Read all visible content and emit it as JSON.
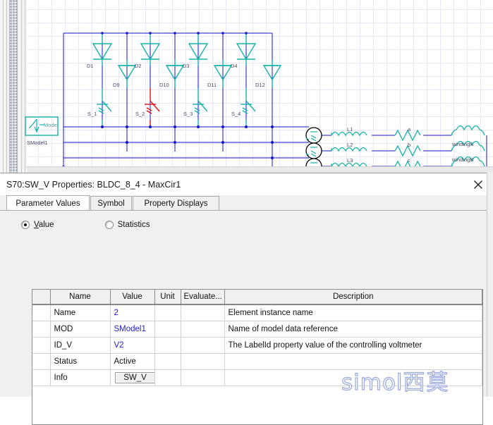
{
  "dialog": {
    "title": "S70:SW_V Properties: BLDC_8_4 - MaxCir1",
    "close_label": "×",
    "tabs": [
      {
        "label": "Parameter Values",
        "active": true
      },
      {
        "label": "Symbol",
        "active": false
      },
      {
        "label": "Property Displays",
        "active": false
      }
    ],
    "radios": [
      {
        "label": "Value",
        "mnemonic": "V",
        "rest": "alue",
        "selected": true
      },
      {
        "label": "Statistics",
        "mnemonic": "",
        "rest": "Statistics",
        "selected": false
      }
    ],
    "table": {
      "columns": [
        "",
        "Name",
        "Value",
        "Unit",
        "Evaluate...",
        "Description"
      ],
      "rows": [
        {
          "name": "Name",
          "value": "2",
          "value_style": "blue",
          "unit": "",
          "evaluate": "",
          "description": "Element instance name"
        },
        {
          "name": "MOD",
          "value": "SModel1",
          "value_style": "blue",
          "unit": "",
          "evaluate": "",
          "description": "Name of model data reference"
        },
        {
          "name": "ID_V",
          "value": "V2",
          "value_style": "blue",
          "unit": "",
          "evaluate": "",
          "description": "The LabelId property value of the controlling voltmeter"
        },
        {
          "name": "Status",
          "value": "Active",
          "value_style": "black",
          "unit": "",
          "evaluate": "",
          "description": ""
        },
        {
          "name": "Info",
          "value": "SW_V",
          "value_style": "button",
          "unit": "",
          "evaluate": "",
          "description": ""
        }
      ]
    }
  },
  "watermark": {
    "latin": "simol",
    "cjk": "西莫"
  },
  "schematic": {
    "model_block_label": "Model",
    "model_block_caption": "SModel1",
    "diodes_top": [
      "D1",
      "D2",
      "D3",
      "D4"
    ],
    "diodes_mid": [
      "D9",
      "D10",
      "D11",
      "D12"
    ],
    "switches": [
      "S_1",
      "S_2",
      "S_3",
      "S_4"
    ],
    "inductors": [
      "L1",
      "L2",
      "L3"
    ],
    "resistors": [
      "a",
      "b",
      "c"
    ],
    "windings": [
      "windingA",
      "windingB"
    ],
    "colors": {
      "wire_blue": "#1414c8",
      "component_teal": "#16b2a8",
      "highlight_red": "#e01010",
      "grid": "#e8e8f4",
      "label": "#4a4a6a"
    }
  }
}
